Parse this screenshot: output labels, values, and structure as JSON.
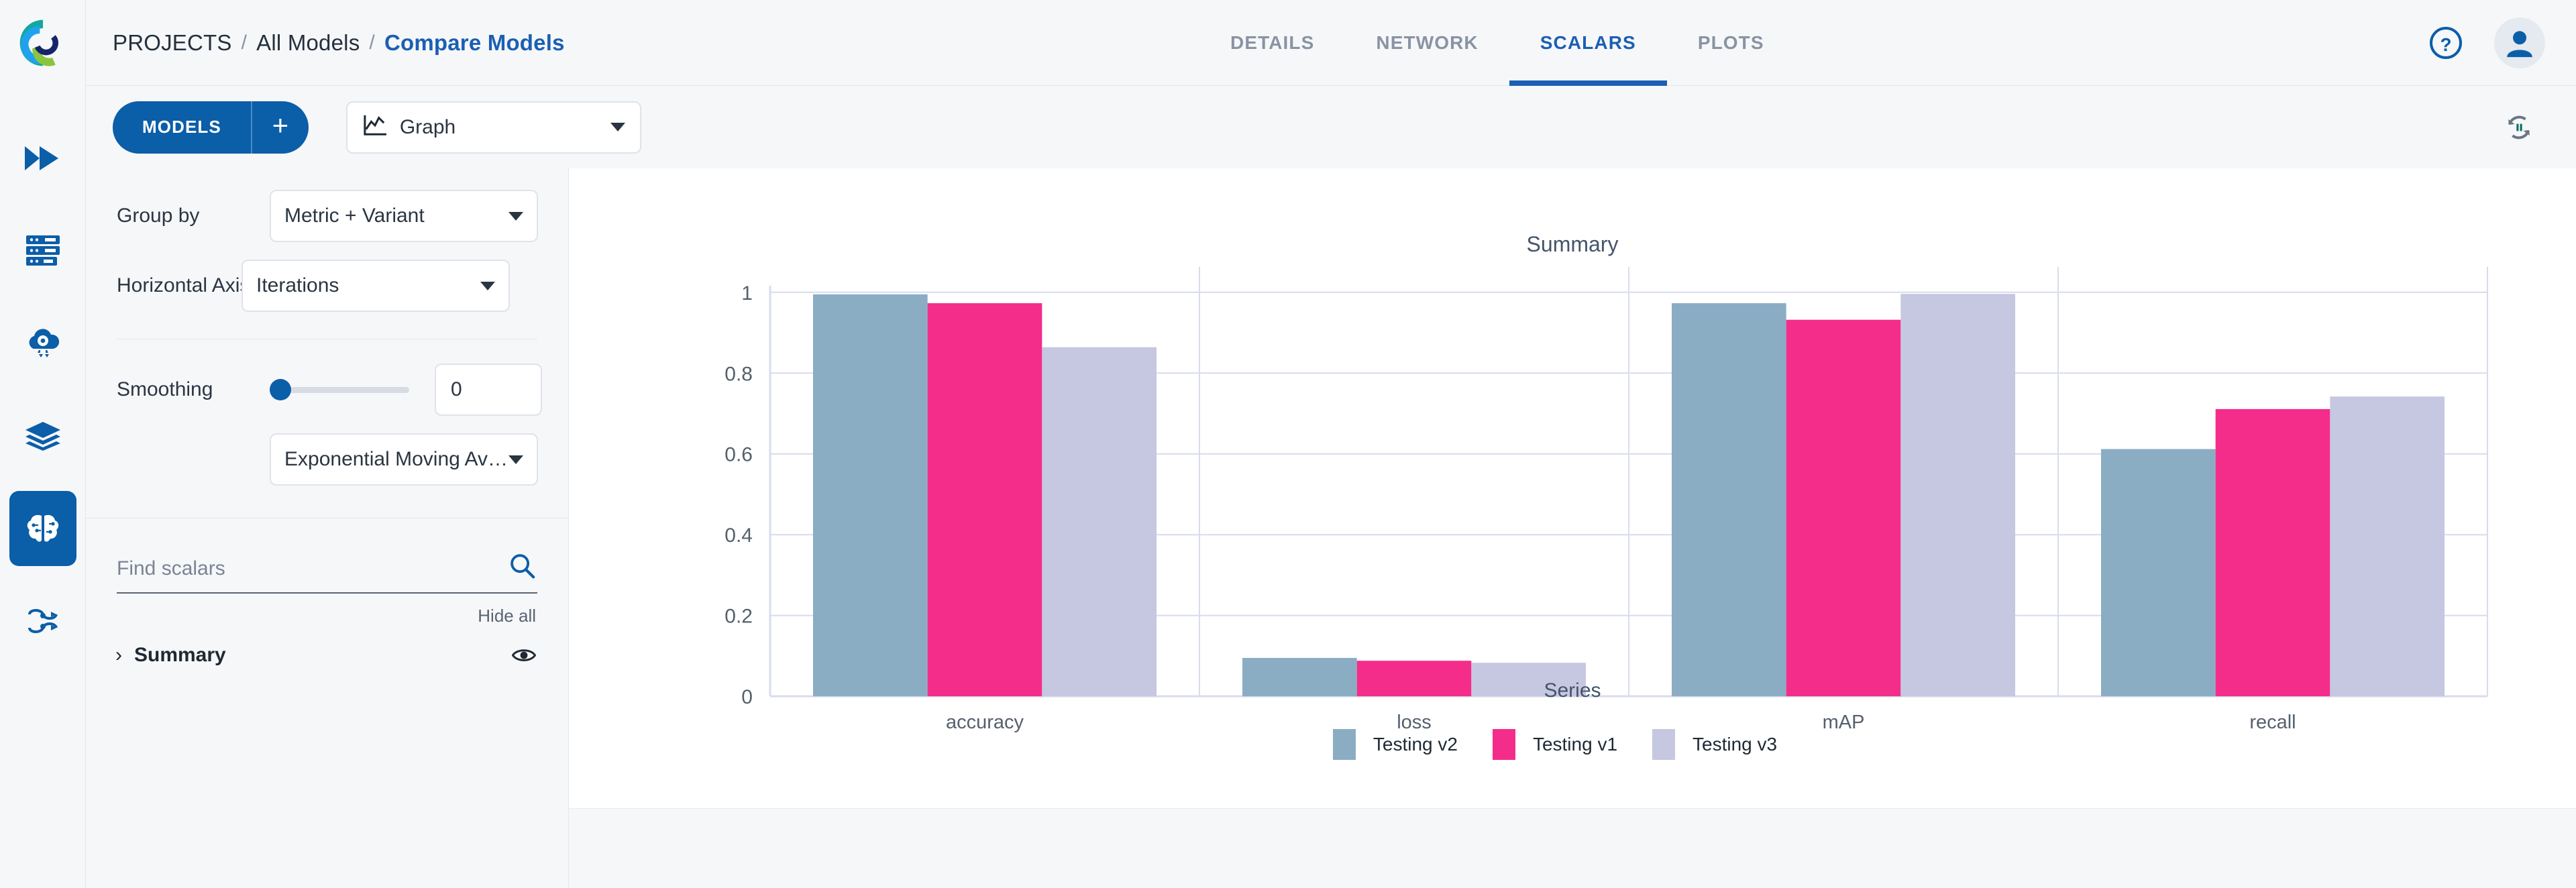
{
  "brand": {
    "logo_icon": "clearml-c-logo"
  },
  "rail": {
    "items": [
      {
        "icon": "pipelines-play-icon",
        "name": "pipelines",
        "active": false
      },
      {
        "icon": "server-stack-icon",
        "name": "datasets",
        "active": false
      },
      {
        "icon": "cloud-gear-icon",
        "name": "orchestration",
        "active": false
      },
      {
        "icon": "layers-icon",
        "name": "dataviews",
        "active": false
      },
      {
        "icon": "brain-icon",
        "name": "models",
        "active": true
      },
      {
        "icon": "workflow-nodes-icon",
        "name": "reports",
        "active": false
      }
    ]
  },
  "header": {
    "breadcrumb": [
      {
        "label": "PROJECTS",
        "current": false
      },
      {
        "label": "All Models",
        "current": false
      },
      {
        "label": "Compare Models",
        "current": true
      }
    ],
    "separator": "/",
    "tabs": [
      {
        "label": "DETAILS",
        "active": false
      },
      {
        "label": "NETWORK",
        "active": false
      },
      {
        "label": "SCALARS",
        "active": true
      },
      {
        "label": "PLOTS",
        "active": false
      }
    ],
    "help_icon": "question-circle-icon",
    "avatar_icon": "user-avatar-icon"
  },
  "toolbar": {
    "models_label": "MODELS",
    "add_label": "+",
    "graph_select": {
      "value": "Graph",
      "icon": "line-chart-icon"
    },
    "refresh_icon": "refresh-pause-icon"
  },
  "panel": {
    "group_by": {
      "label": "Group by",
      "value": "Metric + Variant"
    },
    "horizontal_axis": {
      "label": "Horizontal Axis",
      "value": "Iterations"
    },
    "smoothing": {
      "label": "Smoothing",
      "value": "0",
      "slider_percent": 0
    },
    "smoothing_algorithm": {
      "value": "Exponential Moving Av…"
    },
    "search": {
      "placeholder": "Find scalars",
      "value": "",
      "icon": "search-icon"
    },
    "hide_all_label": "Hide all",
    "groups": [
      {
        "name": "Summary",
        "expanded": false,
        "chevron": "›",
        "eye_icon": "eye-icon"
      }
    ]
  },
  "colors": {
    "accent_blue": "#0b5ea8",
    "link_blue": "#1a5fb4",
    "series_v2": "#8badc4",
    "series_v1": "#f42d8b",
    "series_v3": "#c6c7e0",
    "grid": "#d8dced",
    "axis_text": "#55606e"
  },
  "chart_data": {
    "type": "bar",
    "title": "Summary",
    "xlabel": "Series",
    "ylabel": "",
    "categories": [
      "accuracy",
      "loss",
      "mAP",
      "recall"
    ],
    "series": [
      {
        "name": "Testing v2",
        "color": "#8badc4",
        "values": [
          0.995,
          0.095,
          0.973,
          0.612
        ]
      },
      {
        "name": "Testing v1",
        "color": "#f42d8b",
        "values": [
          0.973,
          0.088,
          0.932,
          0.711
        ]
      },
      {
        "name": "Testing v3",
        "color": "#c6c7e0",
        "values": [
          0.864,
          0.083,
          0.996,
          0.742
        ]
      }
    ],
    "ylim": [
      0,
      1
    ],
    "yticks": [
      0,
      0.2,
      0.4,
      0.6,
      0.8,
      1
    ],
    "ytick_labels": [
      "0",
      "0.2",
      "0.4",
      "0.6",
      "0.8",
      "1"
    ],
    "grid": true,
    "legend_position": "bottom"
  }
}
